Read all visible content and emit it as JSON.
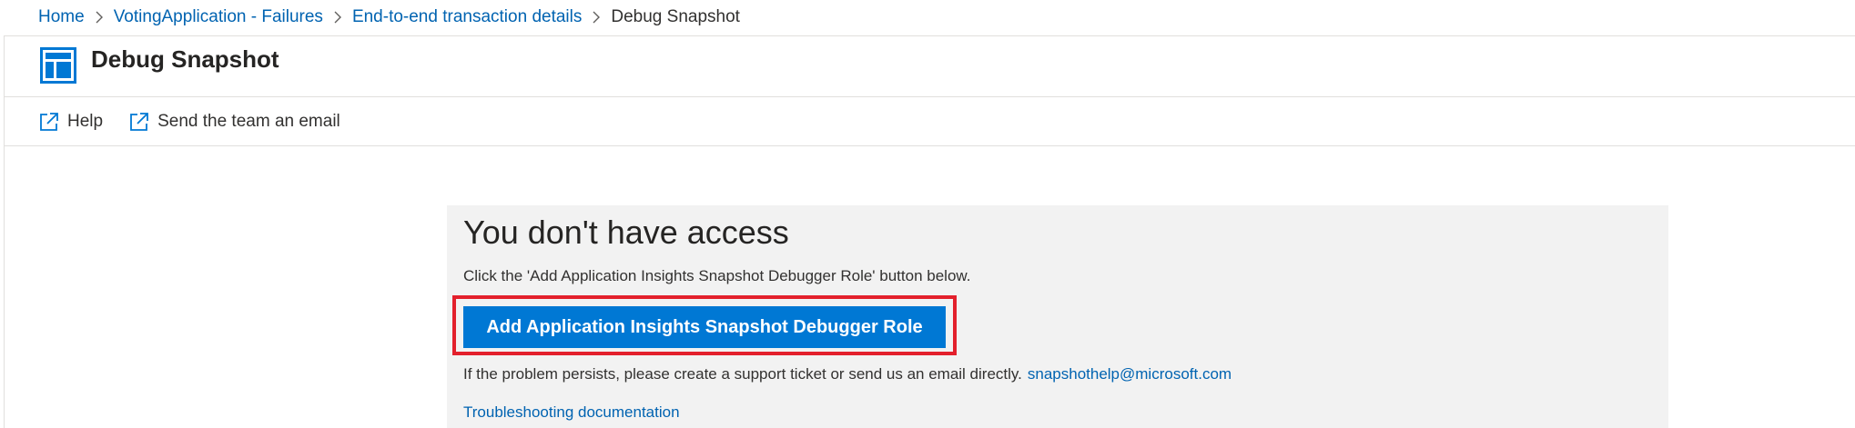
{
  "breadcrumb": {
    "items": [
      {
        "label": "Home"
      },
      {
        "label": "VotingApplication - Failures"
      },
      {
        "label": "End-to-end transaction details"
      }
    ],
    "current": "Debug Snapshot"
  },
  "blade": {
    "title": "Debug Snapshot",
    "icon": "snapshot-blade-icon"
  },
  "toolbar": {
    "help_label": "Help",
    "email_label": "Send the team an email",
    "icon": "external-link-icon"
  },
  "access": {
    "title": "You don't have access",
    "instruction": "Click the 'Add Application Insights Snapshot Debugger Role' button below.",
    "button_label": "Add Application Insights Snapshot Debugger Role",
    "persist_text": "If the problem persists, please create a support ticket or send us an email directly.",
    "email": "snapshothelp@microsoft.com",
    "docs_link": "Troubleshooting documentation"
  },
  "colors": {
    "link": "#0063b1",
    "primary": "#0078d4",
    "highlight": "#e3202c",
    "panel_bg": "#f2f2f2"
  }
}
